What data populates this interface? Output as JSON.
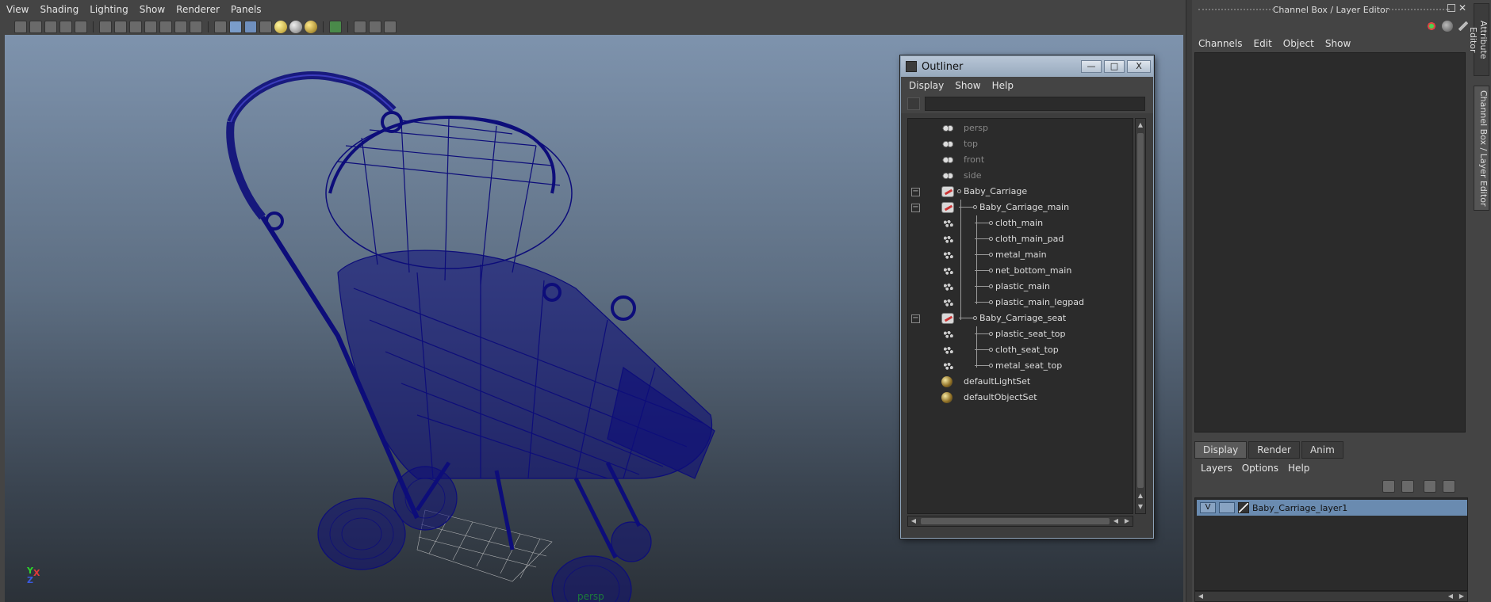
{
  "viewport": {
    "menu": [
      "View",
      "Shading",
      "Lighting",
      "Show",
      "Renderer",
      "Panels"
    ],
    "camera_label": "persp",
    "axis": {
      "y": "Y",
      "x": "X",
      "z": "Z"
    }
  },
  "outliner": {
    "title": "Outliner",
    "window_buttons": {
      "minimize": "—",
      "maximize": "□",
      "close": "X"
    },
    "menu": [
      "Display",
      "Show",
      "Help"
    ],
    "search_placeholder": "",
    "items": [
      {
        "label": "persp",
        "icon": "camera-icon",
        "dim": true
      },
      {
        "label": "top",
        "icon": "camera-icon",
        "dim": true
      },
      {
        "label": "front",
        "icon": "camera-icon",
        "dim": true
      },
      {
        "label": "side",
        "icon": "camera-icon",
        "dim": true
      },
      {
        "label": "Baby_Carriage",
        "icon": "group-icon",
        "expander": "−"
      },
      {
        "label": "Baby_Carriage_main",
        "icon": "group-icon",
        "expander": "−"
      },
      {
        "label": "cloth_main",
        "icon": "mesh-icon"
      },
      {
        "label": "cloth_main_pad",
        "icon": "mesh-icon"
      },
      {
        "label": "metal_main",
        "icon": "mesh-icon"
      },
      {
        "label": "net_bottom_main",
        "icon": "mesh-icon"
      },
      {
        "label": "plastic_main",
        "icon": "mesh-icon"
      },
      {
        "label": "plastic_main_legpad",
        "icon": "mesh-icon"
      },
      {
        "label": "Baby_Carriage_seat",
        "icon": "group-icon",
        "expander": "−"
      },
      {
        "label": "plastic_seat_top",
        "icon": "mesh-icon"
      },
      {
        "label": "cloth_seat_top",
        "icon": "mesh-icon"
      },
      {
        "label": "metal_seat_top",
        "icon": "mesh-icon"
      },
      {
        "label": "defaultLightSet",
        "icon": "set-icon"
      },
      {
        "label": "defaultObjectSet",
        "icon": "set-icon"
      }
    ]
  },
  "channel_box": {
    "title": "Channel Box / Layer Editor",
    "menu": [
      "Channels",
      "Edit",
      "Object",
      "Show"
    ]
  },
  "layer_editor": {
    "tabs": [
      "Display",
      "Render",
      "Anim"
    ],
    "active_tab": "Display",
    "menu": [
      "Layers",
      "Options",
      "Help"
    ],
    "layer": {
      "visible": "V",
      "playback": "",
      "name": "Baby_Carriage_layer1"
    }
  },
  "side_tabs": [
    "Attribute Editor",
    "Channel Box / Layer Editor"
  ],
  "colors": {
    "wireframe": "#0d0d7a",
    "layer_highlight": "#6a8bb0",
    "accent_green": "#1c7a3a"
  }
}
